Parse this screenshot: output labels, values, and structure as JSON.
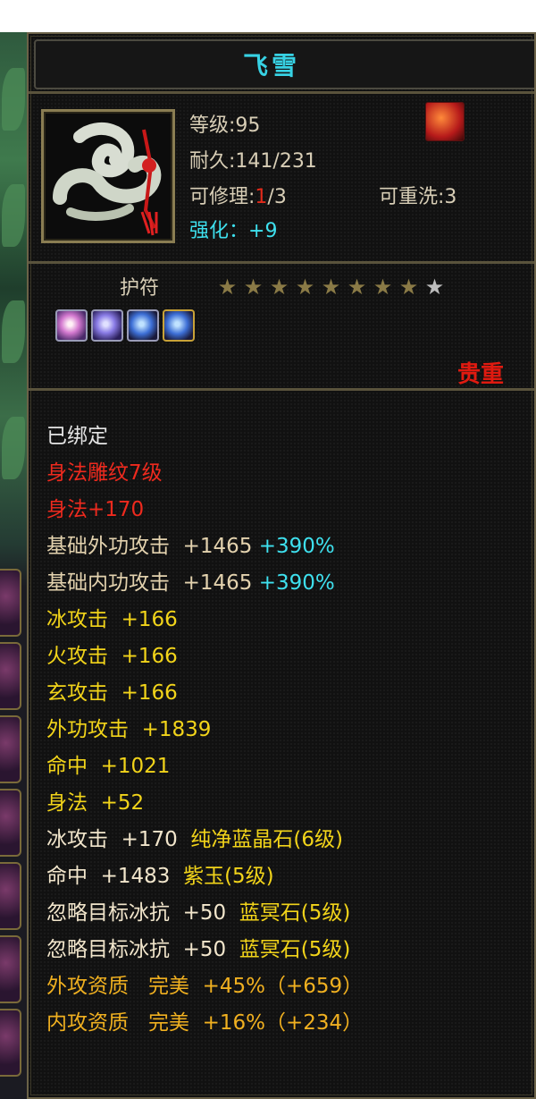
{
  "item": {
    "name": "飞雪",
    "level_label": "等级:95",
    "durability_label": "耐久:141/231",
    "repair_label": "可修理:",
    "repair_used": "1",
    "repair_total": "/3",
    "rewash_label": "可重洗:3",
    "enhance_label": "强化：",
    "enhance_value": "+9",
    "category": "护符",
    "stars_filled": 8,
    "stars_total": 9,
    "rarity": "贵重",
    "badge_icon": "phoenix-icon",
    "item_icon": "jade-amulet-icon",
    "gems": [
      "pink-crystal-gem-icon",
      "violet-crystal-gem-icon",
      "blue-crystal-gem-icon",
      "blue-crystal-gem-icon"
    ]
  },
  "stats": {
    "bound": "已绑定",
    "engrave": "身法雕纹7级",
    "agility_bonus": "身法+170",
    "base_outer_label": "基础外功攻击",
    "base_outer_value": "+1465",
    "base_outer_pct": "+390%",
    "base_inner_label": "基础内功攻击",
    "base_inner_value": "+1465",
    "base_inner_pct": "+390%",
    "ice_attack": "冰攻击",
    "ice_attack_value": "+166",
    "fire_attack": "火攻击",
    "fire_attack_value": "+166",
    "dark_attack": "玄攻击",
    "dark_attack_value": "+166",
    "outer_attack": "外功攻击",
    "outer_attack_value": "+1839",
    "hit": "命中",
    "hit_value": "+1021",
    "agility": "身法",
    "agility_value": "+52",
    "gem1_stat": "冰攻击",
    "gem1_value": "+170",
    "gem1_name": "纯净蓝晶石(6级)",
    "gem2_stat": "命中",
    "gem2_value": "+1483",
    "gem2_name": "紫玉(5级)",
    "gem3_stat": "忽略目标冰抗",
    "gem3_value": "+50",
    "gem3_name": "蓝冥石(5级)",
    "gem4_stat": "忽略目标冰抗",
    "gem4_value": "+50",
    "gem4_name": "蓝冥石(5级)",
    "aptitude1_label": "外攻资质",
    "aptitude1_grade": "完美",
    "aptitude1_value": "+45%（+659）",
    "aptitude2_label": "内攻资质",
    "aptitude2_grade": "完美",
    "aptitude2_value": "+16%（+234）"
  },
  "colors": {
    "title": "#37d2e4",
    "rarity": "#e01a10",
    "bound": "#e4e4e4",
    "engrave": "#ee2a1e",
    "base_stats": "#e3d2ae",
    "pct": "#3ee0ee",
    "attack_stats": "#f2d41a",
    "gem_stats": "#f2e6cc",
    "aptitude": "#f0b020"
  }
}
